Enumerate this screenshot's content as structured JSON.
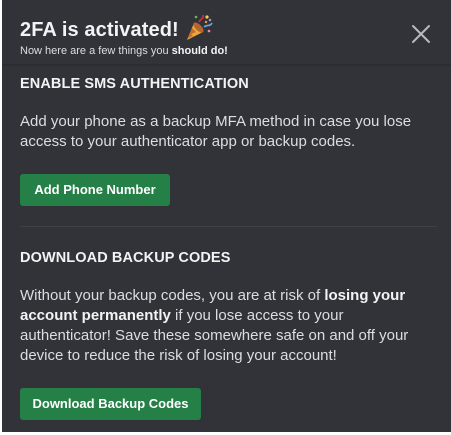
{
  "header": {
    "title": "2FA is activated!",
    "subtitle_prefix": "Now here are a few things you ",
    "subtitle_emphasis": "should do!",
    "title_icon": "party-popper-icon",
    "close_icon": "close-icon"
  },
  "sms_section": {
    "title": "ENABLE SMS AUTHENTICATION",
    "description": "Add your phone as a backup MFA method in case you lose access to your authenticator app or backup codes.",
    "button_label": "Add Phone Number"
  },
  "backup_section": {
    "title": "DOWNLOAD BACKUP CODES",
    "description_before": "Without your backup codes, you are at risk of ",
    "description_emphasis": "losing your account permanently",
    "description_after": " if you lose access to your authenticator! Save these somewhere safe on and off your device to reduce the risk of losing your account!",
    "button_label": "Download Backup Codes"
  },
  "colors": {
    "background": "#313338",
    "button": "#248046",
    "text": "#dbdee1",
    "heading": "#f2f3f5"
  }
}
